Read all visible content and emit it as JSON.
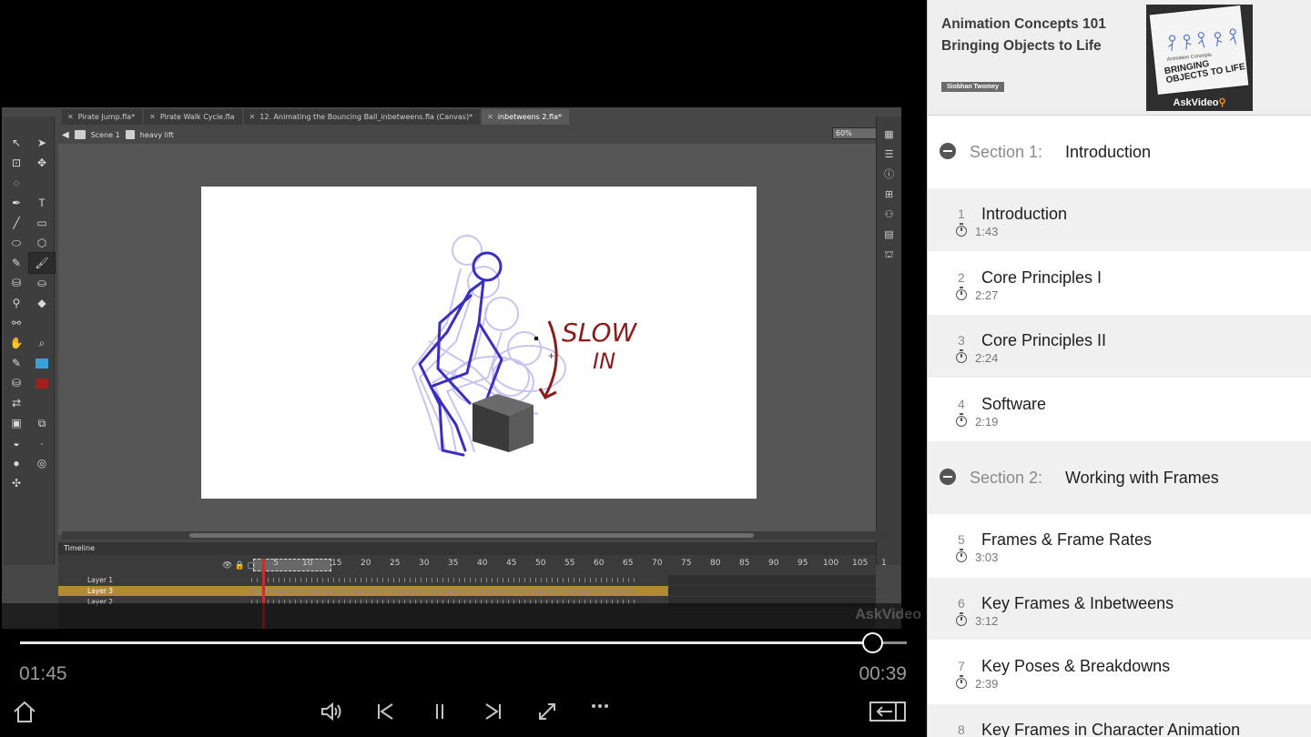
{
  "flash": {
    "tabs": [
      {
        "label": "Pirate Jump.fla*"
      },
      {
        "label": "Pirate Walk Cycle.fla"
      },
      {
        "label": "12.  Animating the Bouncing Ball_inbetweens.fla (Canvas)*"
      },
      {
        "label": "inbetweens 2.fla*"
      }
    ],
    "scene_label": "Scene 1",
    "symbol_label": "heavy lift",
    "zoom_value": "60%",
    "stage_annotation": [
      "SLOW",
      "IN"
    ],
    "timeline": {
      "title": "Timeline",
      "ruler": [
        "5",
        "10",
        "15",
        "20",
        "25",
        "30",
        "35",
        "40",
        "45",
        "50",
        "55",
        "60",
        "65",
        "70",
        "75",
        "80",
        "85",
        "90",
        "95",
        "100",
        "105",
        "1"
      ],
      "layers": [
        "Layer 1",
        "Layer 3",
        "Layer 2"
      ],
      "active_layer": "Layer 3"
    },
    "watermark": "AskVideo"
  },
  "player": {
    "elapsed": "01:45",
    "remaining": "00:39",
    "progress_fraction": 0.961,
    "controls": [
      "home-icon",
      "volume-icon",
      "previous-icon",
      "pause-icon",
      "next-icon",
      "fullscreen-icon",
      "more-icon",
      "exit-panel-icon"
    ]
  },
  "course": {
    "title_line1": "Animation Concepts 101",
    "title_line2": "Bringing Objects to Life",
    "author": "Siobhan Twomey",
    "cover_subtitle": "Animation Concepts",
    "cover_title": "BRINGING OBJECTS TO LIFE",
    "cover_brand": "AskVideo"
  },
  "sections": [
    {
      "label": "Section 1:",
      "name": "Introduction",
      "lessons": [
        {
          "num": "1",
          "title": "Introduction",
          "duration": "1:43"
        },
        {
          "num": "2",
          "title": "Core Principles I",
          "duration": "2:27"
        },
        {
          "num": "3",
          "title": "Core Principles II",
          "duration": "2:24"
        },
        {
          "num": "4",
          "title": "Software",
          "duration": "2:19"
        }
      ]
    },
    {
      "label": "Section 2:",
      "name": "Working with Frames",
      "lessons": [
        {
          "num": "5",
          "title": "Frames & Frame Rates",
          "duration": "3:03"
        },
        {
          "num": "6",
          "title": "Key Frames & Inbetweens",
          "duration": "3:12"
        },
        {
          "num": "7",
          "title": "Key Poses & Breakdowns",
          "duration": "2:39"
        },
        {
          "num": "8",
          "title": "Key Frames in Character Animation",
          "duration": ""
        }
      ]
    }
  ],
  "colors": {
    "stroke_blue": "#3a2fc0",
    "annotation_red": "#8c1c1c",
    "timeline_active": "#b28a35",
    "swatch_stroke": "#3aa0d8",
    "swatch_fill": "#a02020"
  }
}
